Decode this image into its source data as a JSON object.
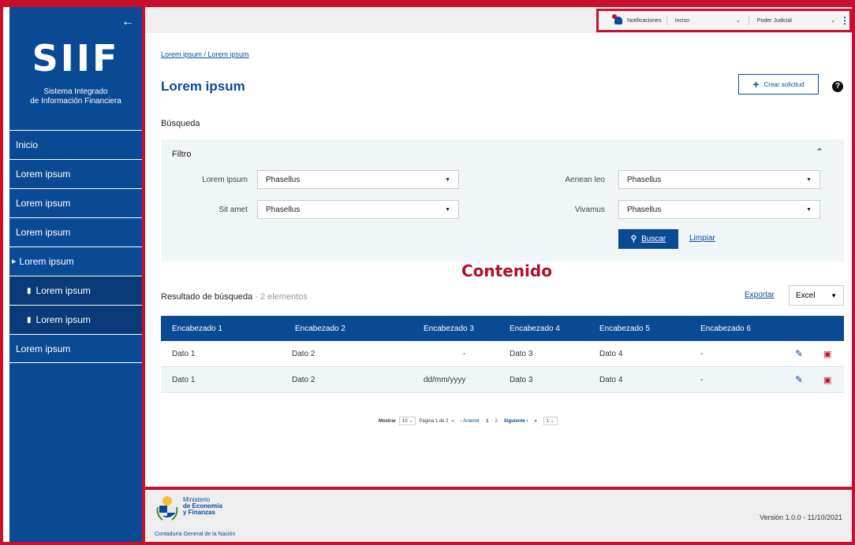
{
  "sidebar": {
    "logo": "SIIF",
    "subtitle_line1": "Sistema Integrado",
    "subtitle_line2": "de Información Financiera",
    "items": [
      {
        "label": "Inicio"
      },
      {
        "label": "Lorem ipsum"
      },
      {
        "label": "Lorem ipsum"
      },
      {
        "label": "Lorem ipsum"
      },
      {
        "label": "Lorem ipsum"
      },
      {
        "label": "Lorem ipsum"
      },
      {
        "label": "Lorem ipsum"
      },
      {
        "label": "Lorem ipsum"
      }
    ]
  },
  "topbar": {
    "notifications": "Notificaciones",
    "inciso": "Inciso",
    "poder": "Poder Judicial"
  },
  "breadcrumb": "Lorem ipsum / Lorem ipsum",
  "page_title": "Lorem ipsum",
  "crear_label": "Crear solicitud",
  "search": {
    "section": "Búsqueda",
    "filter": "Filtro",
    "fields": [
      {
        "label": "Lorem ipsum",
        "value": "Phasellus"
      },
      {
        "label": "Aenean leo",
        "value": "Phasellus"
      },
      {
        "label": "Sit amet",
        "value": "Phasellus"
      },
      {
        "label": "Vivamus",
        "value": "Phasellus"
      }
    ],
    "buscar": "Buscar",
    "limpiar": "Limpiar"
  },
  "contenido": "Contenido",
  "results": {
    "title": "Resultado de búsqueda",
    "count": " - 2 elementos",
    "exportar": "Exportar",
    "format": "Excel",
    "headers": [
      "Encabezado 1",
      "Encabezado 2",
      "Encabezado 3",
      "Encabezado 4",
      "Encabezado 5",
      "Encabezado 6"
    ],
    "rows": [
      [
        "Dato 1",
        "Dato 2",
        "-",
        "Dato 3",
        "Dato 4",
        "-"
      ],
      [
        "Dato 1",
        "Dato 2",
        "dd/mm/yyyy",
        "Dato 3",
        "Dato 4",
        "-"
      ]
    ]
  },
  "pager": {
    "mostrar": "Mostrar",
    "size": "10",
    "pagina": "Página 1 de 2",
    "first": "«",
    "anterior": "‹ Anterior",
    "p1": "1",
    "p2": "2",
    "siguiente": "Siguiente ›",
    "last": "»",
    "goto": "1"
  },
  "footer": {
    "ministerio1": "Ministerio",
    "ministerio2": "de Economía",
    "ministerio3": "y Finanzas",
    "contaduria": "Contaduría General de la Nación",
    "version": "Versión 1.0.0 - 11/10/2021"
  },
  "colors": {
    "primary": "#0a4a94",
    "accent": "#c8102e"
  }
}
